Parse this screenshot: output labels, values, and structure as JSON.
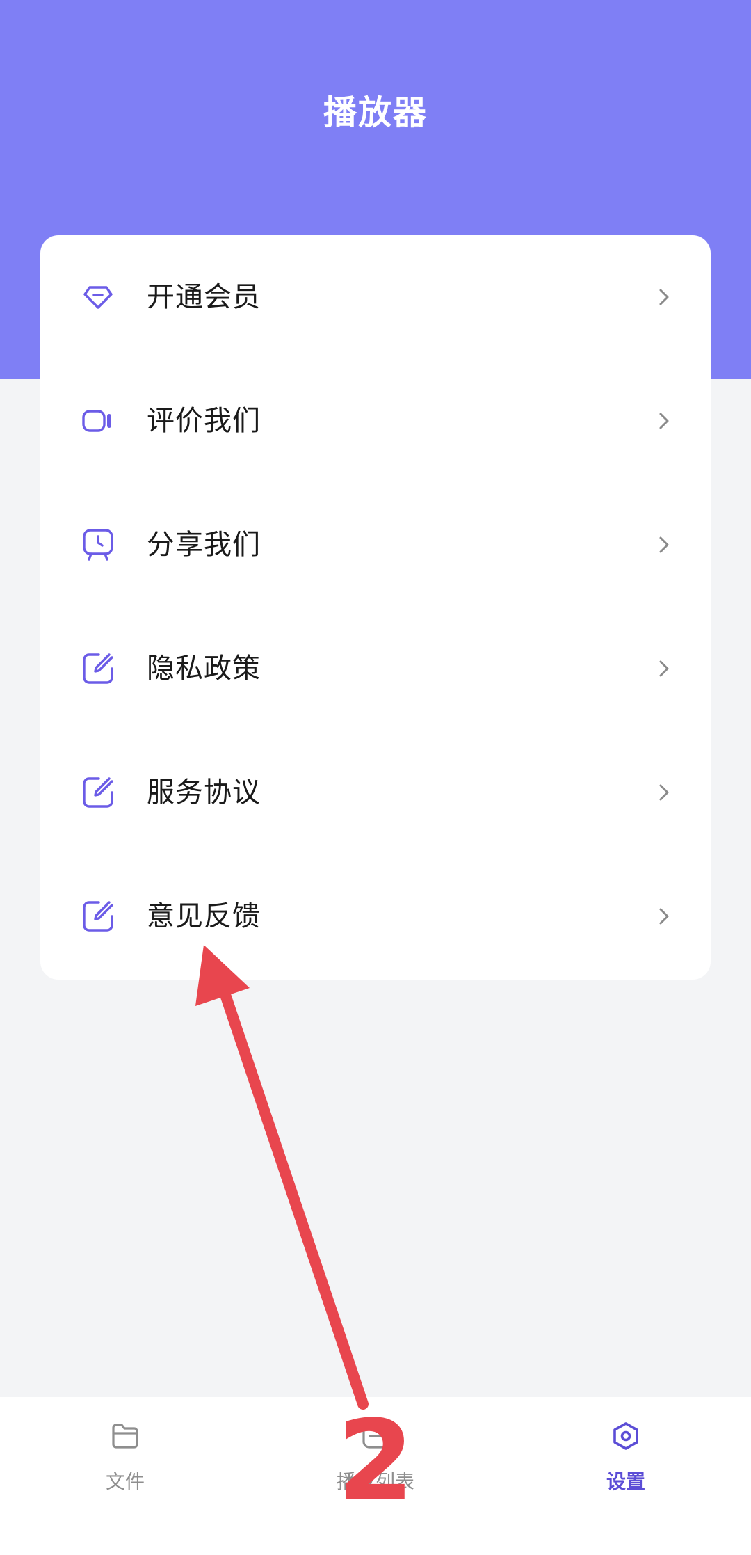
{
  "header": {
    "title": "播放器"
  },
  "settings": {
    "items": [
      {
        "label": "开通会员",
        "icon": "diamond-icon"
      },
      {
        "label": "评价我们",
        "icon": "video-camera-icon"
      },
      {
        "label": "分享我们",
        "icon": "tv-clock-icon"
      },
      {
        "label": "隐私政策",
        "icon": "edit-icon"
      },
      {
        "label": "服务协议",
        "icon": "edit-icon"
      },
      {
        "label": "意见反馈",
        "icon": "edit-icon"
      }
    ]
  },
  "tabs": [
    {
      "label": "文件",
      "icon": "folder-icon",
      "active": false
    },
    {
      "label": "播放列表",
      "icon": "playlist-icon",
      "active": false
    },
    {
      "label": "设置",
      "icon": "settings-icon",
      "active": true
    }
  ],
  "annotation": {
    "step_number": "2"
  },
  "colors": {
    "header_bg": "#7f7ff5",
    "accent": "#5b4dd6",
    "icon": "#6b5ce7",
    "annotation": "#e8464e"
  }
}
